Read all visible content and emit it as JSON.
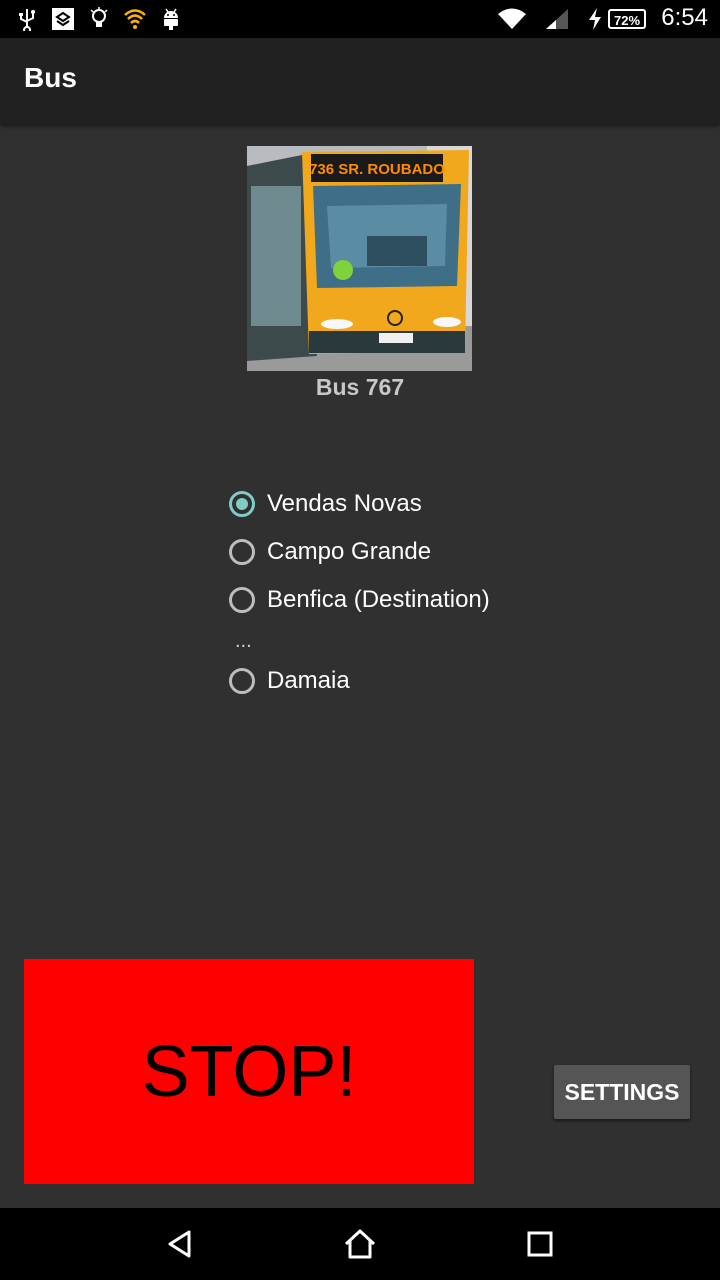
{
  "status_bar": {
    "time": "6:54",
    "battery": "72%",
    "icons": [
      "usb-icon",
      "app-notification-icon",
      "lightbulb-icon",
      "wifi-orange-icon",
      "android-debug-icon",
      "wifi-icon",
      "cell-signal-icon",
      "charging-icon"
    ]
  },
  "app_bar": {
    "title": "Bus"
  },
  "bus": {
    "name": "Bus 767",
    "destination_sign": "736 SR. ROUBADO"
  },
  "stops": [
    {
      "label": "Vendas Novas",
      "checked": true
    },
    {
      "label": "Campo Grande",
      "checked": false
    },
    {
      "label": "Benfica  (Destination)",
      "checked": false
    },
    {
      "label": "Damaia",
      "checked": false
    }
  ],
  "ellipsis": "...",
  "actions": {
    "stop_label": "STOP!",
    "settings_label": "SETTINGS"
  },
  "colors": {
    "stop_button": "#ff0000",
    "radio_accent": "#80cbc4",
    "background": "#303030",
    "app_bar": "#212121"
  },
  "nav_bar": {
    "icons": [
      "back-icon",
      "home-icon",
      "recents-icon"
    ]
  }
}
